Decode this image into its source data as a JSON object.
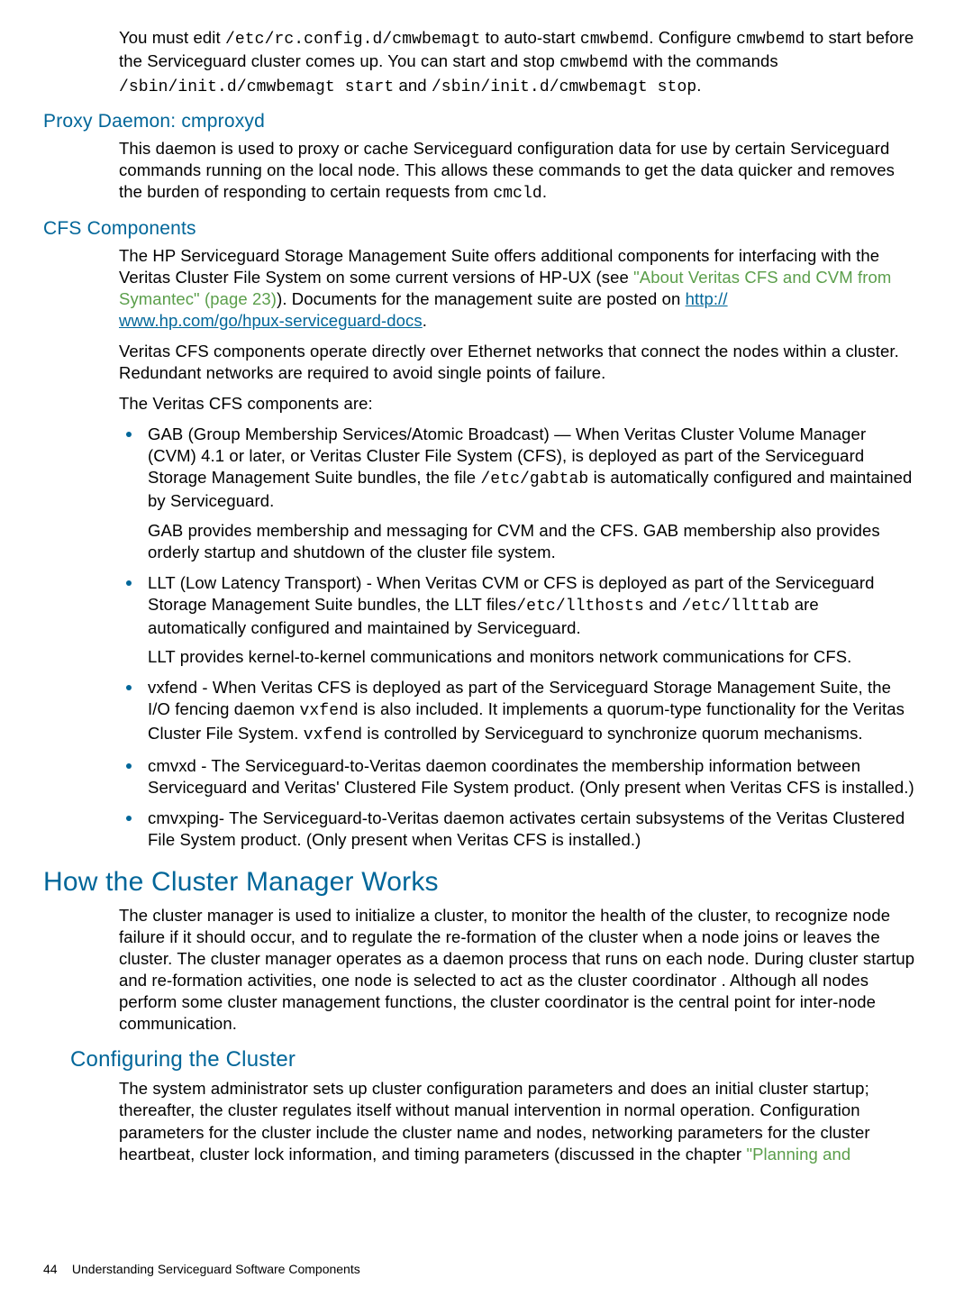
{
  "intro": {
    "p1_a": "You must edit ",
    "p1_code1": "/etc/rc.config.d/cmwbemagt",
    "p1_b": " to auto-start ",
    "p1_code2": "cmwbemd",
    "p1_c": ". Configure ",
    "p1_code3": "cmwbemd",
    "p1_d": " to start before the Serviceguard cluster comes up. You can start and stop ",
    "p1_code4": "cmwbemd",
    "p1_e": " with the commands ",
    "p1_code5": "/sbin/init.d/cmwbemagt start",
    "p1_f": " and ",
    "p1_code6": "/sbin/init.d/cmwbemagt stop",
    "p1_g": "."
  },
  "proxy": {
    "heading": "Proxy Daemon: cmproxyd",
    "p1_a": "This daemon is used to proxy or cache Serviceguard configuration data for use by certain Serviceguard commands running on the local node. This allows these commands to get the data quicker and removes the burden of responding to certain requests from ",
    "p1_code": "cmcld",
    "p1_b": "."
  },
  "cfs": {
    "heading": "CFS Components",
    "p1_a": "The HP Serviceguard Storage Management Suite offers additional components for interfacing with the Veritas Cluster File System on some current versions of HP-UX (see ",
    "p1_link1": "\"About Veritas CFS and CVM from Symantec\" (page 23)",
    "p1_b": "). Documents for the management suite are posted on ",
    "p1_link2a": "http://",
    "p1_link2b": "www.hp.com/go/hpux-serviceguard-docs",
    "p1_c": ".",
    "p2": "Veritas CFS components operate directly over Ethernet networks that connect the nodes within a cluster. Redundant networks are required to avoid single points of failure.",
    "p3": "The Veritas CFS components are:",
    "items": [
      {
        "a": "GAB (Group Membership Services/Atomic Broadcast) — When Veritas Cluster Volume Manager (CVM) 4.1 or later, or Veritas Cluster File System (CFS), is deployed as part of the Serviceguard Storage Management Suite bundles, the file ",
        "code1": "/etc/gabtab",
        "b": " is automatically configured and maintained by Serviceguard.",
        "sub": "GAB provides membership and messaging for CVM and the CFS. GAB membership also provides orderly startup and shutdown of the cluster file system."
      },
      {
        "a": "LLT (Low Latency Transport) - When Veritas CVM or CFS is deployed as part of the Serviceguard Storage Management Suite bundles, the LLT files",
        "code1": "/etc/llthosts",
        "mid": " and ",
        "code2": "/etc/llttab",
        "b": " are automatically configured and maintained by Serviceguard.",
        "sub": "LLT provides kernel-to-kernel communications and monitors network communications for CFS."
      },
      {
        "a": "vxfend - When Veritas CFS is deployed as part of the Serviceguard Storage Management Suite, the I/O fencing daemon ",
        "code1": "vxfend",
        "mid": " is also included. It implements a quorum-type functionality for the Veritas Cluster File System. ",
        "code2": "vxfend",
        "b": " is controlled by Serviceguard to synchronize quorum mechanisms."
      },
      {
        "a": "cmvxd - The Serviceguard-to-Veritas daemon coordinates the membership information between Serviceguard and Veritas' Clustered File System product. (Only present when Veritas CFS is installed.)"
      },
      {
        "a": "cmvxping- The Serviceguard-to-Veritas daemon activates certain subsystems of the Veritas Clustered File System product. (Only present when Veritas CFS is installed.)"
      }
    ]
  },
  "how": {
    "heading": "How the Cluster Manager Works",
    "p1": "The cluster manager is used to initialize a cluster, to monitor the health of the cluster, to recognize node failure if it should occur, and to regulate the re-formation of the cluster when a node joins or leaves the cluster. The cluster manager operates as a daemon process that runs on each node. During cluster startup and re-formation activities, one node is selected to act as the cluster coordinator . Although all nodes perform some cluster management functions, the cluster coordinator is the central point for inter-node communication."
  },
  "config": {
    "heading": "Configuring the Cluster",
    "p1_a": "The system administrator sets up cluster configuration parameters and does an initial cluster startup; thereafter, the cluster regulates itself without manual intervention in normal operation. Configuration parameters for the cluster include the cluster name and nodes, networking parameters for the cluster heartbeat, cluster lock information, and timing parameters (discussed in the chapter ",
    "p1_link": "\"Planning and"
  },
  "footer": {
    "page": "44",
    "title": "Understanding Serviceguard Software Components"
  }
}
